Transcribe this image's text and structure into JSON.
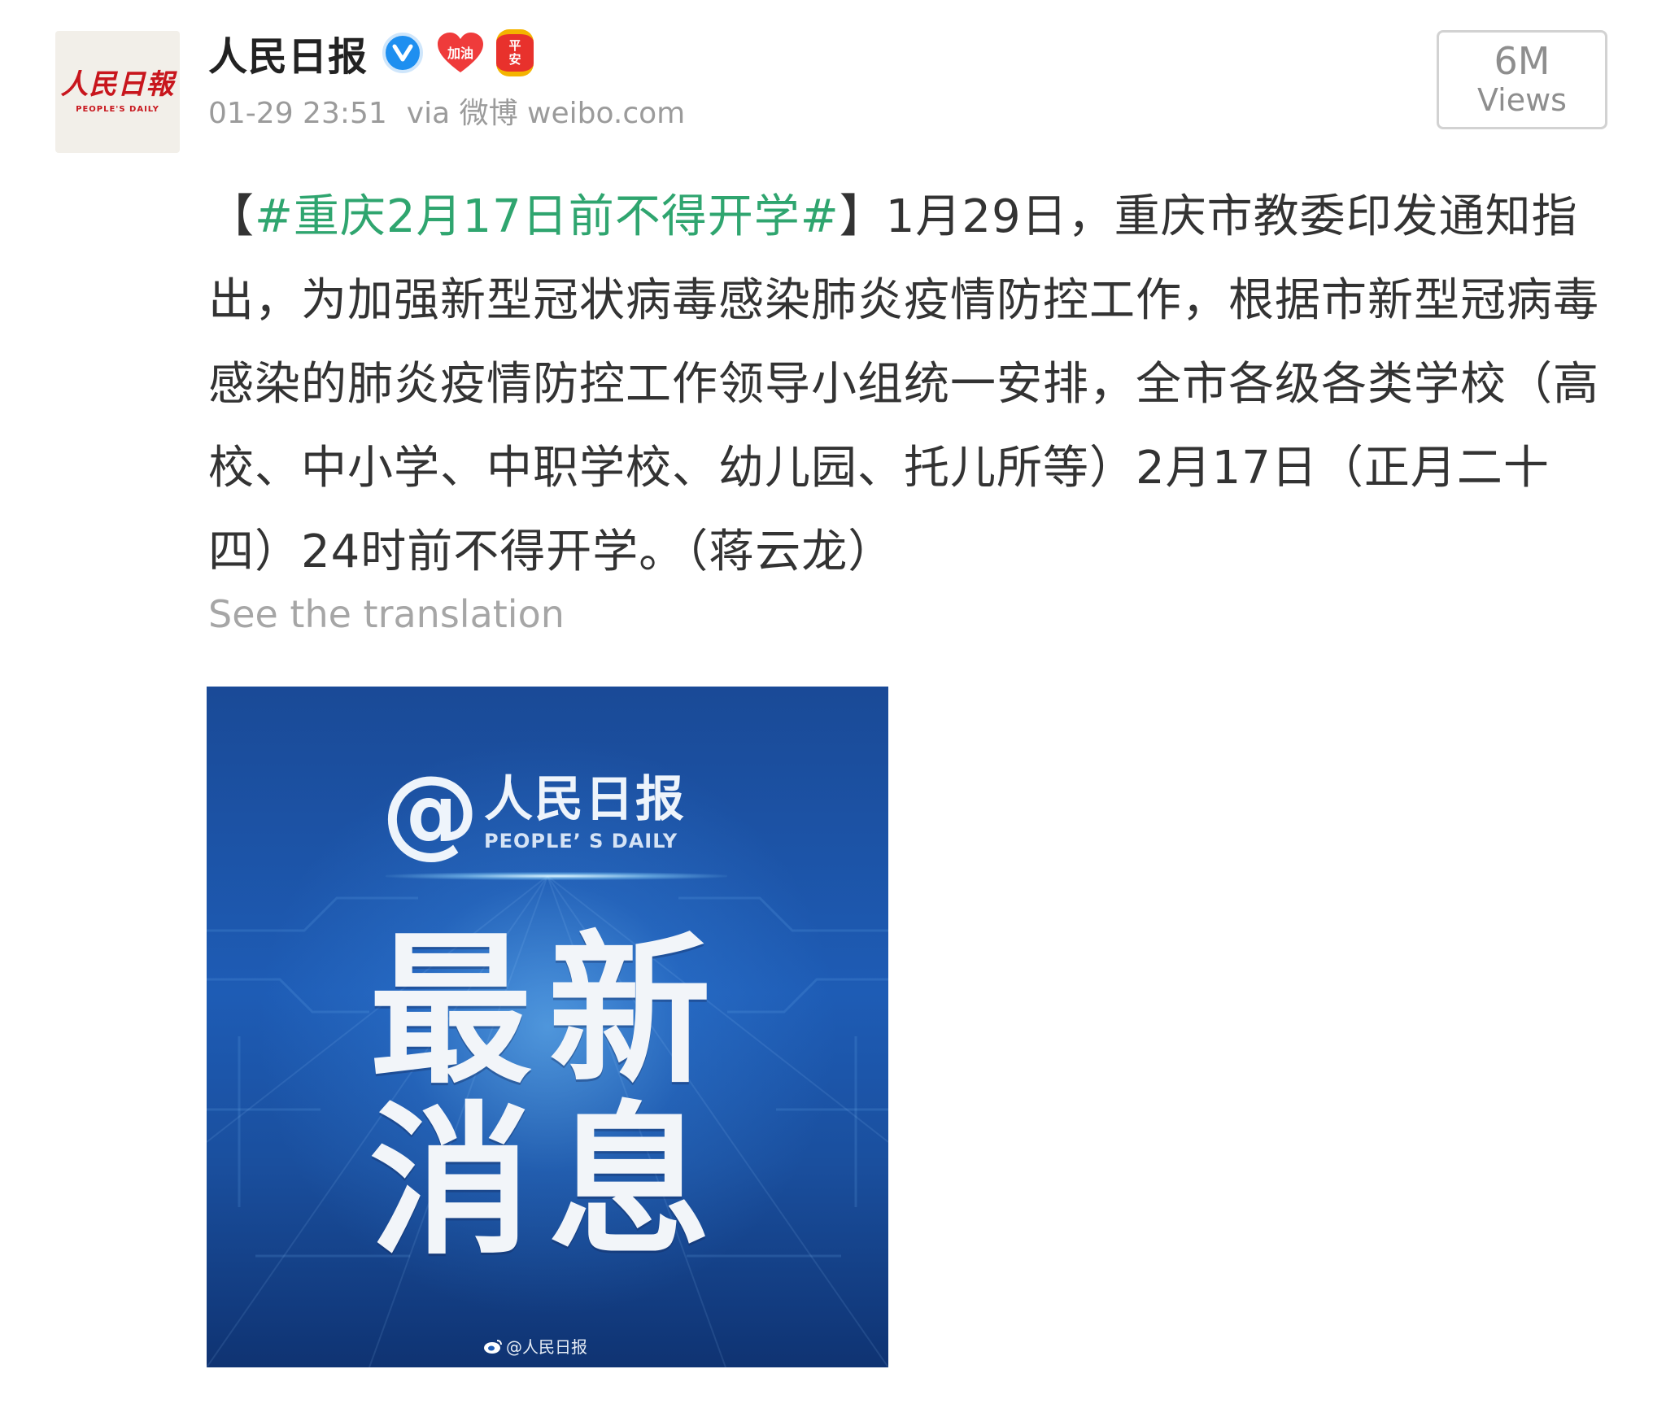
{
  "account": {
    "name": "人民日报",
    "avatar_text_cn": "人民日報",
    "avatar_text_en": "PEOPLE'S DAILY",
    "badge_heart_label": "加油",
    "badge_lantern_label_1": "平",
    "badge_lantern_label_2": "安"
  },
  "meta": {
    "datetime": "01-29 23:51",
    "via": "via 微博 weibo.com"
  },
  "views": {
    "count": "6M",
    "label": "Views"
  },
  "post": {
    "bracket_open": "【",
    "hashtag": "#重庆2月17日前不得开学#",
    "bracket_close": "】",
    "body": "1月29日，重庆市教委印发通知指出，为加强新型冠状病毒感染肺炎疫情防控工作，根据市新型冠病毒感染的肺炎疫情防控工作领导小组统一安排，全市各级各类学校（高校、中小学、中职学校、幼儿园、托儿所等）2月17日（正月二十四）24时前不得开学。（蒋云龙）",
    "translate_link": "See the translation"
  },
  "image": {
    "logo_at": "@",
    "logo_cn": "人民日报",
    "logo_en": "PEOPLE’ S DAILY",
    "headline_line1": "最新",
    "headline_line2": "消息",
    "watermark": "@人民日报"
  },
  "colors": {
    "hashtag": "#2fa56f",
    "verified": "#1e8ff0",
    "text": "#333333",
    "muted": "#9b9b9b",
    "image_bg": "#1e5cb5"
  },
  "icons": [
    "verified-icon",
    "heart-badge-icon",
    "lantern-badge-icon",
    "weibo-icon"
  ]
}
